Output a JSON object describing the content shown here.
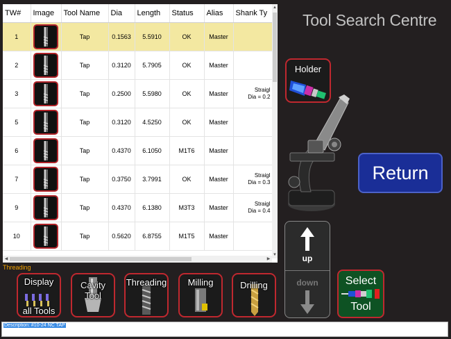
{
  "title": "Tool Search Centre",
  "table": {
    "headers": [
      "TW#",
      "Image",
      "Tool Name",
      "Dia",
      "Length",
      "Status",
      "Alias",
      "Shank Ty"
    ],
    "rows": [
      {
        "tw": "1",
        "name": "Tap",
        "dia": "0.1563",
        "length": "5.5910",
        "status": "OK",
        "alias": "Master",
        "shank1": "",
        "shank2": "",
        "selected": true
      },
      {
        "tw": "2",
        "name": "Tap",
        "dia": "0.3120",
        "length": "5.7905",
        "status": "OK",
        "alias": "Master",
        "shank1": "",
        "shank2": ""
      },
      {
        "tw": "3",
        "name": "Tap",
        "dia": "0.2500",
        "length": "5.5980",
        "status": "OK",
        "alias": "Master",
        "shank1": "Straigl",
        "shank2": "Dia = 0.2"
      },
      {
        "tw": "5",
        "name": "Tap",
        "dia": "0.3120",
        "length": "4.5250",
        "status": "OK",
        "alias": "Master",
        "shank1": "",
        "shank2": ""
      },
      {
        "tw": "6",
        "name": "Tap",
        "dia": "0.4370",
        "length": "6.1050",
        "status": "M1T6",
        "alias": "Master",
        "shank1": "",
        "shank2": ""
      },
      {
        "tw": "7",
        "name": "Tap",
        "dia": "0.3750",
        "length": "3.7991",
        "status": "OK",
        "alias": "Master",
        "shank1": "Straigl",
        "shank2": "Dia = 0.3"
      },
      {
        "tw": "9",
        "name": "Tap",
        "dia": "0.4370",
        "length": "6.1380",
        "status": "M3T3",
        "alias": "Master",
        "shank1": "Straigl",
        "shank2": "Dia = 0.4"
      },
      {
        "tw": "10",
        "name": "Tap",
        "dia": "0.5620",
        "length": "6.8755",
        "status": "M1T5",
        "alias": "Master",
        "shank1": "",
        "shank2": ""
      }
    ]
  },
  "holder_label": "Holder",
  "return_label": "Return",
  "nav": {
    "up_label": "up",
    "down_label": "down"
  },
  "select_tool": {
    "line1": "Select",
    "line2": "Tool"
  },
  "category_label": "Threading",
  "categories": {
    "display_all": {
      "line1": "Display",
      "line2": "all Tools"
    },
    "cavity": {
      "line1": "Cavity",
      "line2": "Tool"
    },
    "threading": "Threading",
    "milling": "Milling",
    "drilling": "Drilling"
  },
  "description": "Description: #10-24 NC TAP",
  "colors": {
    "selected_row": "#f3e8a1",
    "button_border": "#c0282f",
    "return_bg": "#1a2e97",
    "select_bg": "#0e5223",
    "category_text": "#f3a300"
  }
}
